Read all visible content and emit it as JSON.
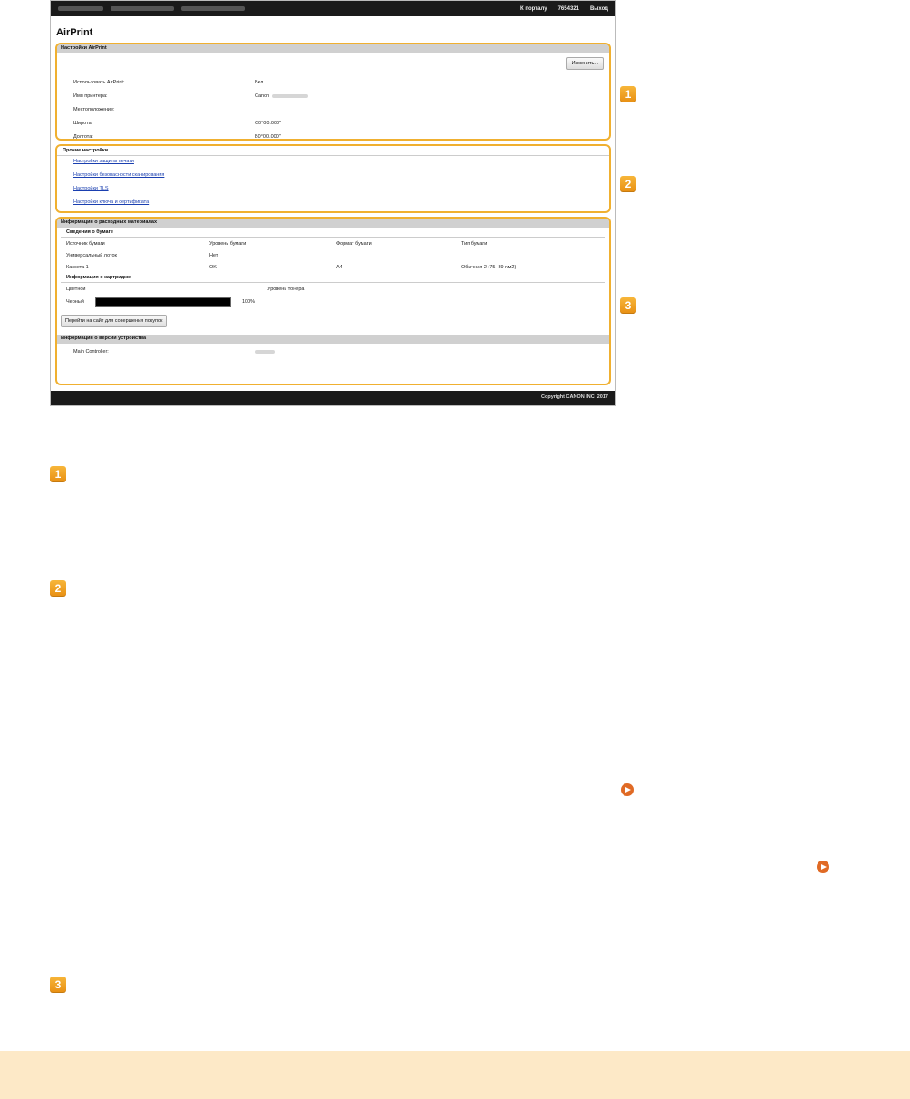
{
  "header": {
    "portal_link": "К порталу",
    "user_id": "7654321",
    "logout": "Выход"
  },
  "page_title": "AirPrint",
  "airprint_settings": {
    "heading": "Настройки AirPrint",
    "edit_button": "Изменить...",
    "rows": [
      {
        "label": "Использовать AirPrint:",
        "value": "Вкл."
      },
      {
        "label": "Имя принтера:",
        "value": "Canon"
      },
      {
        "label": "Местоположение:",
        "value": ""
      },
      {
        "label": "Широта:",
        "value": "С0°0'0.000\""
      },
      {
        "label": "Долгота:",
        "value": "В0°0'0.000\""
      }
    ]
  },
  "other_settings": {
    "heading": "Прочие настройки",
    "links": [
      "Настройки защиты печати",
      "Настройки безопасности сканирования",
      "Настройки TLS",
      "Настройки ключа и сертификата"
    ]
  },
  "consumables": {
    "heading": "Информация о расходных материалах",
    "paper_heading": "Сведения о бумаге",
    "paper_columns": [
      "Источник бумаги",
      "Уровень бумаги",
      "Формат бумаги",
      "Тип бумаги"
    ],
    "paper_rows": [
      [
        "Универсальный лоток",
        "Нет",
        "",
        ""
      ],
      [
        "Кассета 1",
        "OK",
        "A4",
        "Обычная 2 (75–89 г/м2)"
      ]
    ],
    "cartridge_heading": "Информация о картридже",
    "cartridge_columns": [
      "Цветной",
      "Уровень тонера"
    ],
    "cartridge": {
      "color": "Черный",
      "level": "100%",
      "level_fraction": 1.0
    },
    "buy_button": "Перейти на сайт для совершения покупок"
  },
  "version_info": {
    "heading": "Информация о версии устройства",
    "label": "Main Controller:"
  },
  "footer": "Copyright CANON INC. 2017",
  "callouts": [
    "1",
    "2",
    "3"
  ],
  "colors": {
    "accent": "#f0b030",
    "link": "#1a3fb0",
    "note_bg": "#fde9c7",
    "arrow": "#e06a25"
  }
}
